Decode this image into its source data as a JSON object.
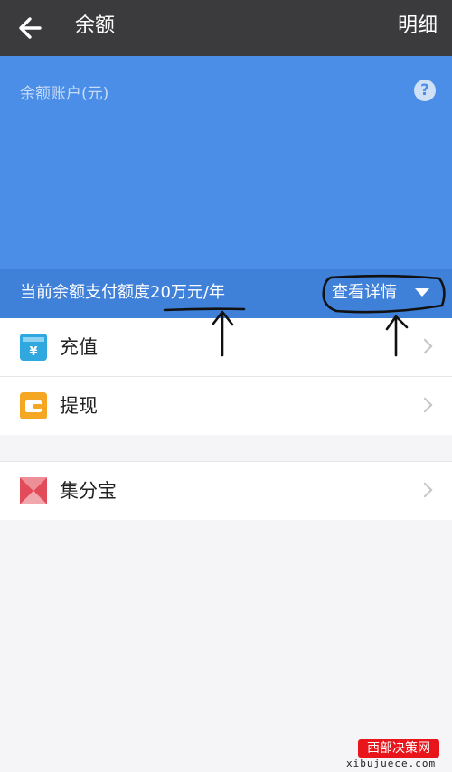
{
  "topbar": {
    "title": "余额",
    "detail_label": "明细"
  },
  "balance": {
    "account_label": "余额账户(元)",
    "help_symbol": "?"
  },
  "limit": {
    "text": "当前余额支付额度20万元/年",
    "view_detail_label": "查看详情"
  },
  "list_group_1": [
    {
      "label": "充值",
      "icon": "recharge-icon"
    },
    {
      "label": "提现",
      "icon": "withdraw-icon"
    }
  ],
  "list_group_2": [
    {
      "label": "集分宝",
      "icon": "jifenbao-icon"
    }
  ],
  "watermark": {
    "text": "西部决策网",
    "domain": "xibujuece.com"
  },
  "colors": {
    "topbar": "#3b3b3d",
    "panel": "#4b8ee7",
    "strip": "#3f80d9",
    "recharge": "#2fa8e0",
    "withdraw": "#f5a623",
    "jifenbao": "#e24b5a"
  }
}
